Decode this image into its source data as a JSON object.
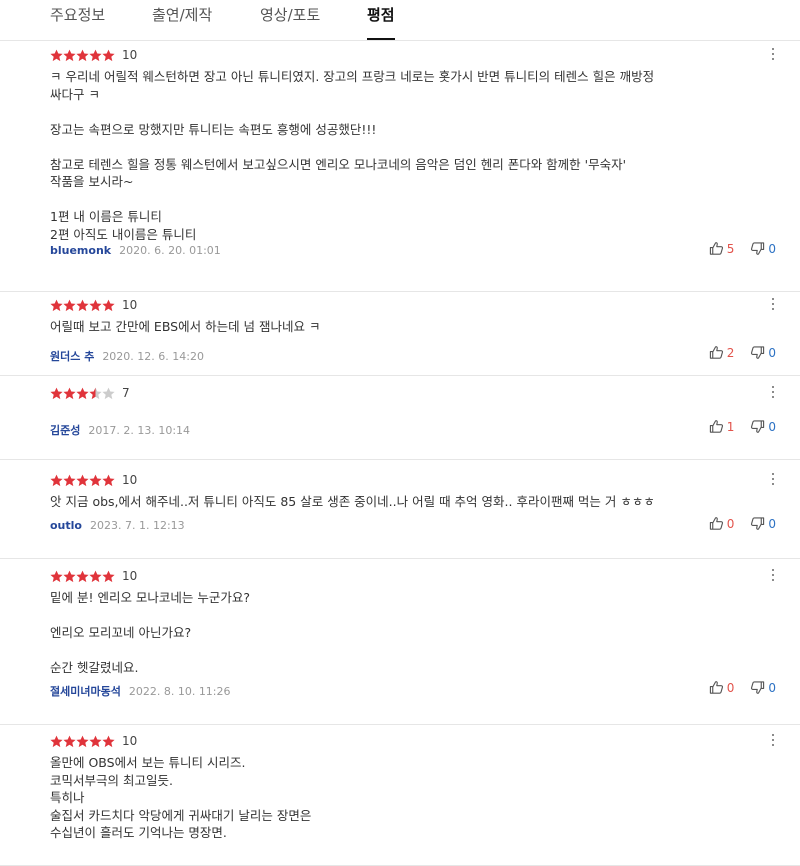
{
  "tabs": [
    "주요정보",
    "출연/제작",
    "영상/포토",
    "평점"
  ],
  "colors": {
    "star_on": "#e0343b",
    "star_off": "#cccccc",
    "author": "#25479a",
    "up": "#e2534b",
    "down": "#2d72c4"
  },
  "reviews": [
    {
      "rating": 5,
      "score": "10",
      "text": "ㅋ 우리네 어릴적 웨스턴하면 장고 아닌 튜니티였지. 장고의 프랑크 네로는 홋가시 반면 튜니티의 테렌스 힐은 깨방정\n싸다구 ㅋ\n\n장고는 속편으로 망했지만 튜니티는 속편도 흥행에 성공했단!!!\n\n참고로 테렌스 힐을 정통 웨스턴에서 보고싶으시면 엔리오 모나코네의 음악은 덤인 헨리 폰다와 함께한 '무숙자'\n작품을 보시라~\n\n1편 내 이름은 튜니티\n2편 아직도 내이름은 튜니티",
      "author": "bluemonk",
      "date": "2020. 6. 20. 01:01",
      "up": "5",
      "down": "0"
    },
    {
      "rating": 5,
      "score": "10",
      "text": "어릴때 보고 간만에 EBS에서 하는데 넘 잼나네요 ㅋ",
      "author": "원더스 추",
      "date": "2020. 12. 6. 14:20",
      "up": "2",
      "down": "0"
    },
    {
      "rating": 3.5,
      "score": "7",
      "text": "",
      "author": "김준성",
      "date": "2017. 2. 13. 10:14",
      "up": "1",
      "down": "0"
    },
    {
      "rating": 5,
      "score": "10",
      "text": "앗 지금 obs,에서 해주네..저 튜니티 아직도 85 살로 생존 중이네..나 어릴 때 추억 영화.. 후라이팬째 먹는 거 ㅎㅎㅎ",
      "author": "outlo",
      "date": "2023. 7. 1. 12:13",
      "up": "0",
      "down": "0"
    },
    {
      "rating": 5,
      "score": "10",
      "text": "밑에 분! 엔리오 모나코네는 누군가요?\n\n엔리오 모리꼬네 아닌가요?\n\n순간  헷갈렸네요.",
      "author": "절세미녀마동석",
      "date": "2022. 8. 10. 11:26",
      "up": "0",
      "down": "0"
    },
    {
      "rating": 5,
      "score": "10",
      "text": "올만에  OBS에서 보는  튜니티 시리즈.\n코믹서부극의 최고일듯.\n특히나\n술집서 카드치다 악당에게  귀싸대기 날리는 장면은\n수십년이 흘러도  기억나는 명장면.",
      "author": "",
      "date": "",
      "up": "",
      "down": ""
    }
  ]
}
